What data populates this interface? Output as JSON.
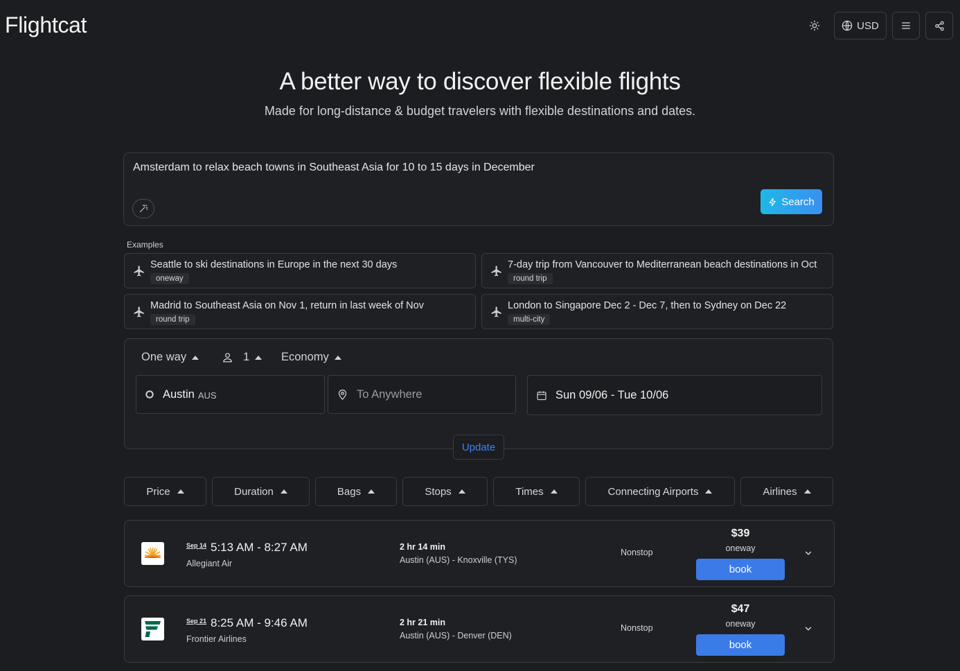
{
  "header": {
    "logo": "Flightcat",
    "currency_label": "USD",
    "icons": [
      "sun-icon",
      "globe-icon",
      "menu-icon",
      "share-icon"
    ]
  },
  "hero": {
    "title": "A better way to discover flexible flights",
    "subtitle": "Made for long-distance & budget travelers with flexible destinations and dates."
  },
  "prompt": {
    "value": "Amsterdam to relax beach towns in Southeast Asia for 10 to 15 days  in December",
    "search_label": "Search"
  },
  "examples": {
    "label": "Examples",
    "items": [
      {
        "text": "Seattle to ski destinations in Europe in the next 30 days",
        "tag": "oneway"
      },
      {
        "text": "7-day trip from Vancouver to Mediterranean beach destinations in Oct",
        "tag": "round trip"
      },
      {
        "text": "Madrid to Southeast Asia on Nov 1, return in last week of Nov",
        "tag": "round trip"
      },
      {
        "text": "London to Singapore Dec 2 - Dec 7, then to Sydney on Dec 22",
        "tag": "multi-city"
      }
    ]
  },
  "form": {
    "trip_type": "One way",
    "passengers": "1",
    "cabin": "Economy",
    "origin_city": "Austin",
    "origin_code": "AUS",
    "destination_placeholder": "To Anywhere",
    "dates": "Sun 09/06 - Tue 10/06",
    "update_label": "Update"
  },
  "filters": [
    "Price",
    "Duration",
    "Bags",
    "Stops",
    "Times",
    "Connecting Airports",
    "Airlines"
  ],
  "flights": [
    {
      "date": "Sep 14",
      "time": "5:13 AM - 8:27 AM",
      "airline": "Allegiant Air",
      "duration": "2 hr 14 min",
      "route": "Austin (AUS) - Knoxville (TYS)",
      "stops": "Nonstop",
      "price": "$39",
      "type": "oneway",
      "book_label": "book"
    },
    {
      "date": "Sep 21",
      "time": "8:25 AM - 9:46 AM",
      "airline": "Frontier Airlines",
      "duration": "2 hr 21 min",
      "route": "Austin (AUS) - Denver (DEN)",
      "stops": "Nonstop",
      "price": "$47",
      "type": "oneway",
      "book_label": "book"
    }
  ],
  "colors": {
    "background": "#1c1d20",
    "accent": "#3b7be8",
    "search_gradient_start": "#1fb8e8",
    "search_gradient_end": "#3a8ff0"
  }
}
